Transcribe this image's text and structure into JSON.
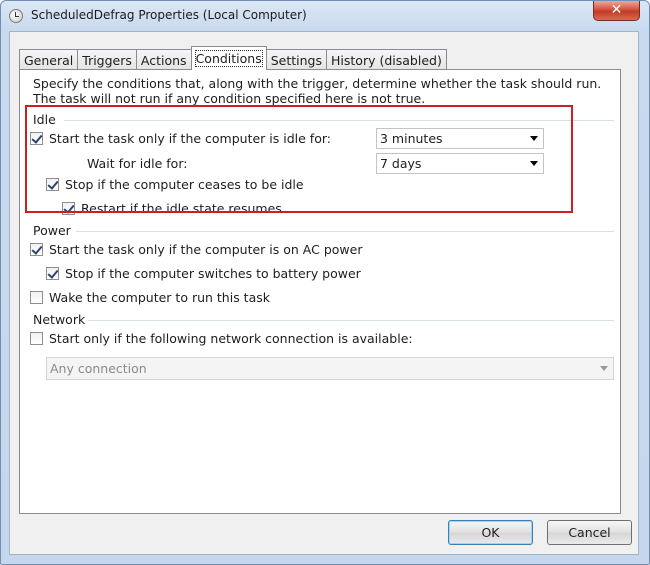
{
  "window": {
    "title": "ScheduledDefrag Properties (Local Computer)",
    "close_label": "✕"
  },
  "tabs": [
    {
      "label": "General"
    },
    {
      "label": "Triggers"
    },
    {
      "label": "Actions"
    },
    {
      "label": "Conditions",
      "active": true
    },
    {
      "label": "Settings"
    },
    {
      "label": "History (disabled)"
    }
  ],
  "description": "Specify the conditions that, along with the trigger, determine whether the task should run.  The task will not run  if any condition specified here is not true.",
  "idle": {
    "group_label": "Idle",
    "start_idle": {
      "label": "Start the task only if the computer is idle for:",
      "checked": true
    },
    "idle_duration": "3 minutes",
    "wait_label": "Wait for idle for:",
    "wait_duration": "7 days",
    "stop_ceases": {
      "label": "Stop if the computer ceases to be idle",
      "checked": true
    },
    "restart_resumes": {
      "label": "Restart if the idle state resumes",
      "checked": true
    }
  },
  "power": {
    "group_label": "Power",
    "ac_power": {
      "label": "Start the task only if the computer is on AC power",
      "checked": true
    },
    "battery": {
      "label": "Stop if the computer switches to battery power",
      "checked": true
    },
    "wake": {
      "label": "Wake the computer to run this task",
      "checked": false
    }
  },
  "network": {
    "group_label": "Network",
    "start_only": {
      "label": "Start only if the following network connection is available:",
      "checked": false
    },
    "connection": "Any connection"
  },
  "buttons": {
    "ok": "OK",
    "cancel": "Cancel"
  },
  "colors": {
    "highlight_box": "#cc1f1f",
    "close_button": "#c23b25"
  }
}
